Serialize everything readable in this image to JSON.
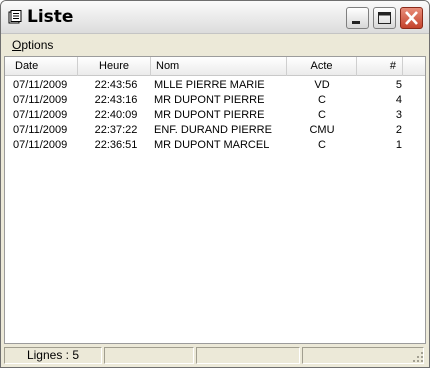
{
  "window": {
    "title": "Liste",
    "icon": "document-icon",
    "controls": [
      "minimize-icon",
      "maximize-icon",
      "close-icon"
    ]
  },
  "menu": {
    "options": "Options"
  },
  "table": {
    "columns": [
      "Date",
      "Heure",
      "Nom",
      "Acte",
      "#"
    ],
    "rows": [
      {
        "date": "07/11/2009",
        "heure": "22:43:56",
        "nom": "MLLE PIERRE MARIE",
        "acte": "VD",
        "num": "5"
      },
      {
        "date": "07/11/2009",
        "heure": "22:43:16",
        "nom": "MR DUPONT PIERRE",
        "acte": "C",
        "num": "4"
      },
      {
        "date": "07/11/2009",
        "heure": "22:40:09",
        "nom": "MR DUPONT PIERRE",
        "acte": "C",
        "num": "3"
      },
      {
        "date": "07/11/2009",
        "heure": "22:37:22",
        "nom": "ENF. DURAND PIERRE",
        "acte": "CMU",
        "num": "2"
      },
      {
        "date": "07/11/2009",
        "heure": "22:36:51",
        "nom": "MR DUPONT MARCEL",
        "acte": "C",
        "num": "1"
      }
    ]
  },
  "status": {
    "lines": "Lignes : 5"
  },
  "colors": {
    "close_button": "#c4432c",
    "window_bg": "#ece9d8"
  }
}
